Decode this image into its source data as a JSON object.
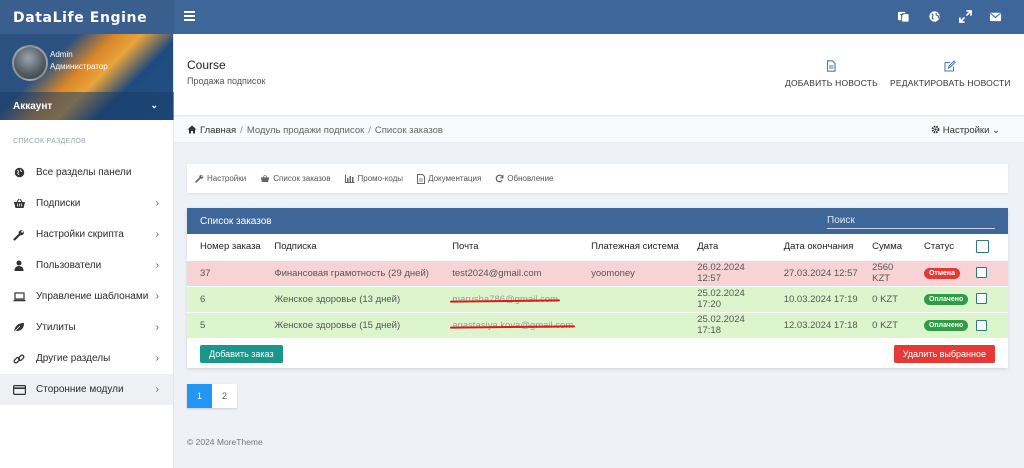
{
  "app": {
    "brand": "DataLife Engine"
  },
  "topbar": {
    "icons": [
      "menu-icon",
      "translate-icon",
      "globe-icon",
      "expand-icon",
      "mail-icon"
    ]
  },
  "profile": {
    "name": "Admin",
    "role": "Администратор",
    "account_label": "Аккаунт"
  },
  "sidebar": {
    "heading": "СПИСОК РАЗДЕЛОВ",
    "items": [
      {
        "label": "Все разделы панели",
        "icon": "globe-icon",
        "has_chevron": false
      },
      {
        "label": "Подписки",
        "icon": "basket-icon",
        "has_chevron": true
      },
      {
        "label": "Настройки скрипта",
        "icon": "wrench-icon",
        "has_chevron": true
      },
      {
        "label": "Пользователи",
        "icon": "user-icon",
        "has_chevron": true
      },
      {
        "label": "Управление шаблонами",
        "icon": "laptop-icon",
        "has_chevron": true
      },
      {
        "label": "Утилиты",
        "icon": "leaf-icon",
        "has_chevron": true
      },
      {
        "label": "Другие разделы",
        "icon": "link-icon",
        "has_chevron": true
      },
      {
        "label": "Сторонние модули",
        "icon": "card-icon",
        "has_chevron": true,
        "active": true
      }
    ]
  },
  "header": {
    "title": "Course",
    "subtitle": "Продажа подписок",
    "actions": [
      {
        "label": "ДОБАВИТЬ НОВОСТЬ",
        "icon": "file-icon"
      },
      {
        "label": "РЕДАКТИРОВАТЬ НОВОСТИ",
        "icon": "edit-icon"
      }
    ]
  },
  "breadcrumb": {
    "items": [
      "Главная",
      "Модуль продажи подписок",
      "Список заказов"
    ],
    "settings_label": "Настройки"
  },
  "tabs": [
    {
      "label": "Настройки",
      "icon": "wrench-icon"
    },
    {
      "label": "Список заказов",
      "icon": "basket-icon"
    },
    {
      "label": "Промо-коды",
      "icon": "chart-icon"
    },
    {
      "label": "Документация",
      "icon": "doc-icon"
    },
    {
      "label": "Обновление",
      "icon": "refresh-icon"
    }
  ],
  "orders": {
    "title": "Список заказов",
    "search_placeholder": "Поиск",
    "columns": [
      "Номер заказа",
      "Подписка",
      "Почта",
      "Платежная система",
      "Дата",
      "Дата окончания",
      "Сумма",
      "Статус"
    ],
    "rows": [
      {
        "id": "37",
        "subscription": "Финансовая грамотность (29 дней)",
        "email": "test2024@gmail.com",
        "email_redacted": false,
        "payment": "yoomoney",
        "date": "26.02.2024 12:57",
        "end_date": "27.03.2024 12:57",
        "sum": "2560 KZT",
        "status": "Отмена",
        "status_color": "#e53935",
        "row_state": "red"
      },
      {
        "id": "6",
        "subscription": "Женское здоровье (13 дней)",
        "email": "marusha786@gmail.com",
        "email_redacted": true,
        "payment": "",
        "date": "25.02.2024 17:20",
        "end_date": "10.03.2024 17:19",
        "sum": "0 KZT",
        "status": "Оплачено",
        "status_color": "#2e9e45",
        "row_state": "green"
      },
      {
        "id": "5",
        "subscription": "Женское здоровье (15 дней)",
        "email": "anastasiya.kova@gmail.com",
        "email_redacted": true,
        "payment": "",
        "date": "25.02.2024 17:18",
        "end_date": "12.03.2024 17:18",
        "sum": "0 KZT",
        "status": "Оплачено",
        "status_color": "#2e9e45",
        "row_state": "green"
      }
    ],
    "add_button": "Добавить заказ",
    "delete_button": "Удалить выбранное"
  },
  "pagination": {
    "pages": [
      "1",
      "2"
    ],
    "current": "1"
  },
  "footer": {
    "text": "© 2024 MoreTheme"
  },
  "colors": {
    "topbar": "#3f6698",
    "brand_bg": "#3a5f8f",
    "accent_teal": "#18978a",
    "danger": "#e53935",
    "success": "#2e9e45",
    "page_active": "#2196f3"
  }
}
